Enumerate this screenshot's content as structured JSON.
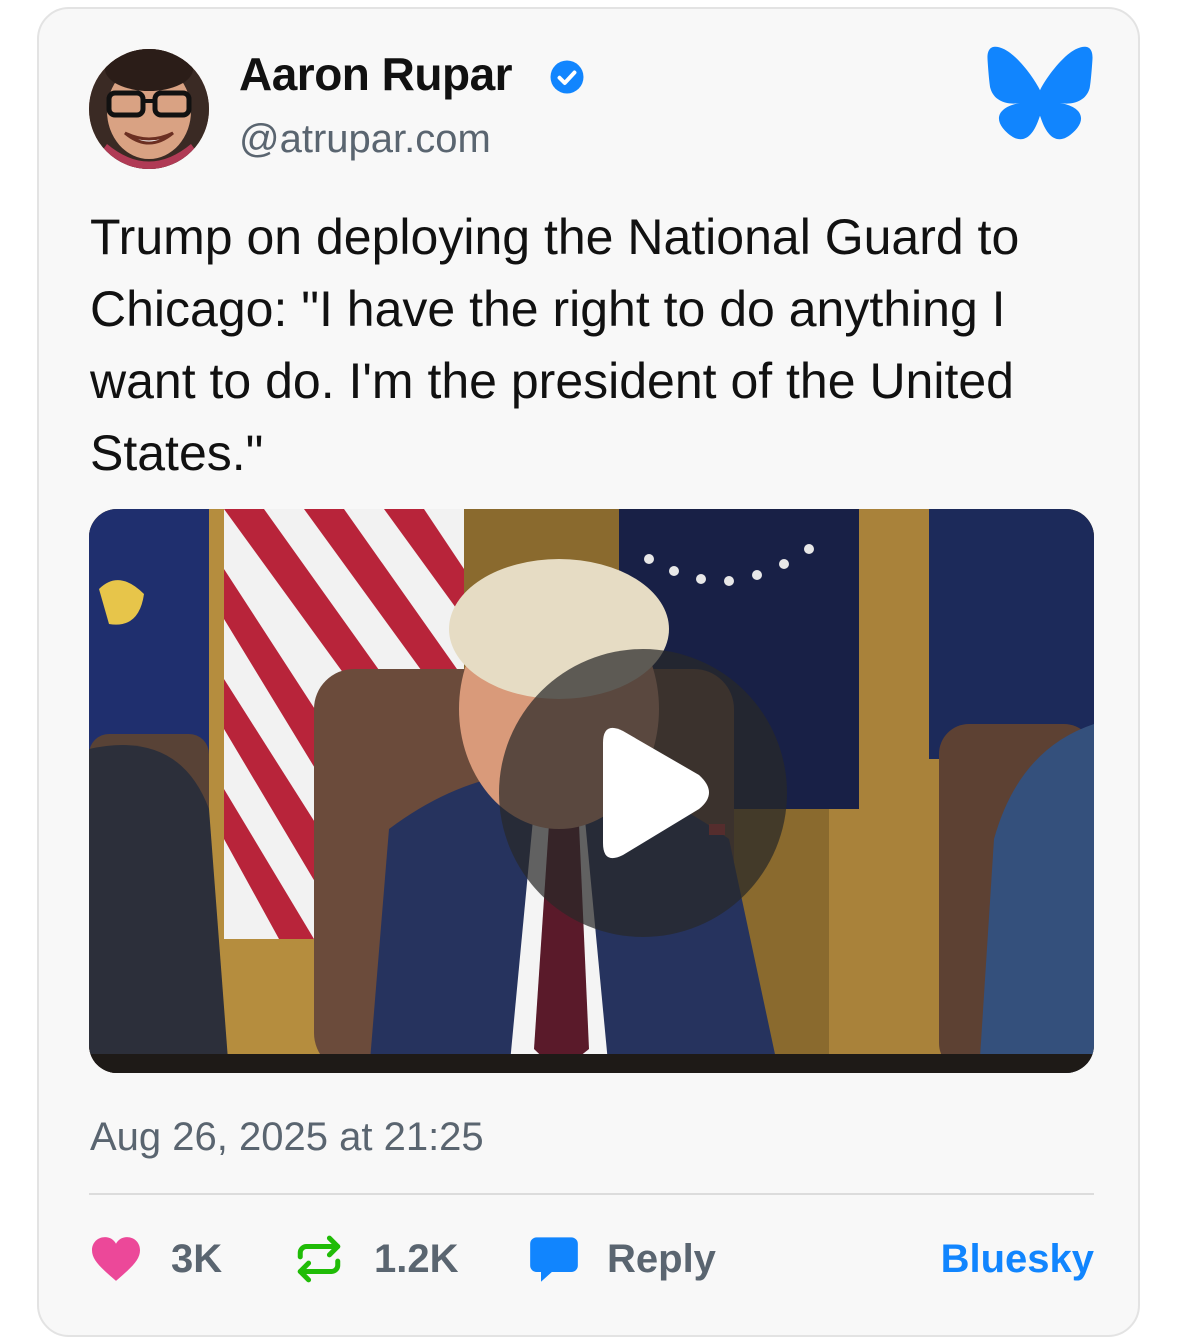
{
  "author": {
    "name": "Aaron Rupar",
    "handle": "@atrupar.com",
    "avatar_icon": "avatar-photo",
    "verified_icon": "verified-check-icon"
  },
  "post": {
    "text": "Trump on deploying the National Guard to Chicago: \"I have the right to do anything I want to do. I'm the president of the United States.\"",
    "media_type": "video",
    "play_icon": "play-icon"
  },
  "timestamp": "Aug 26, 2025 at 21:25",
  "stats": {
    "likes": "3K",
    "reposts": "1.2K",
    "reply_label": "Reply"
  },
  "footer": {
    "link_label": "Bluesky"
  },
  "colors": {
    "accent": "#1185fe",
    "like": "#ec4899",
    "repost": "#20bc07",
    "reply": "#1185fe",
    "muted_text": "#5a6570"
  }
}
